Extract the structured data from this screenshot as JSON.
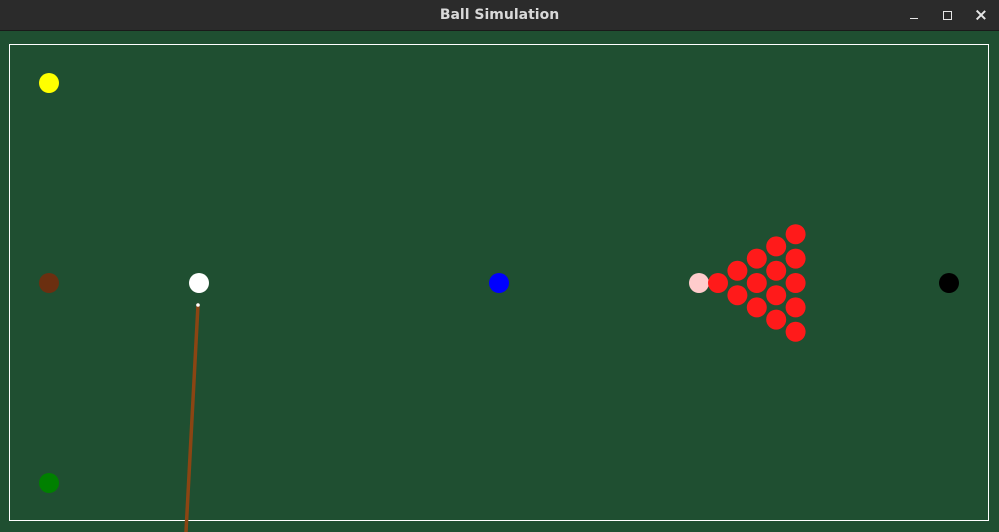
{
  "window": {
    "title": "Ball Simulation"
  },
  "colors": {
    "felt": "#1f4f31",
    "cushion_border": "#ffffff",
    "cue_ball": "#ffffff",
    "yellow": "#ffff00",
    "brown": "#6b2f10",
    "green": "#008000",
    "blue": "#0000ff",
    "pink": "#ffcccc",
    "black": "#000000",
    "red": "#ff1a1a",
    "cue_stick": "#8b4513"
  },
  "balls": {
    "cue": "cue_ball",
    "colored": [
      "yellow",
      "brown",
      "green",
      "blue",
      "pink",
      "black"
    ],
    "red_count": 15
  }
}
